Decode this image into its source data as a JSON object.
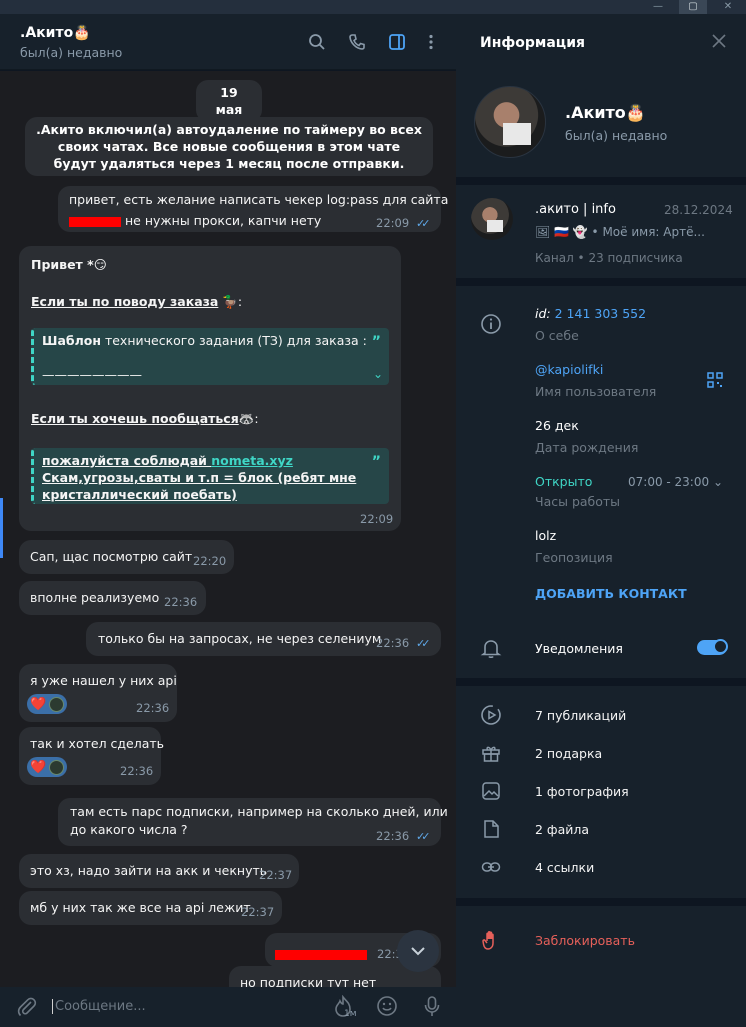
{
  "window": {
    "minimize_glyph": "—",
    "maximize_glyph": "▢",
    "close_glyph": "✕"
  },
  "chat": {
    "name": ".Акито",
    "name_emoji": "🎂",
    "status": "был(а) недавно",
    "icons": [
      "search-icon",
      "phone-icon",
      "sidebar-toggle-icon",
      "more-vertical-icon"
    ]
  },
  "messages": {
    "date": "19 мая",
    "service_text": ".Акито включил(а) автоудаление по таймеру во всех своих чатах. Все новые сообщения в этом чате будут удаляться через 1 месяц после отправки.",
    "m1": {
      "line1": "привет, есть желание написать чекер log:pass для сайта",
      "line2": "не нужны прокси, капчи нету",
      "time": "22:09"
    },
    "m2": {
      "greeting": "Привет",
      "greeting_emoji": "*😏",
      "order_heading": "Если ты по поводу заказа",
      "order_suffix": ":",
      "quote1_bold": "Шаблон",
      "quote1_text": " технического задания (ТЗ) для заказа :",
      "quote1_line2": "————————",
      "chat_heading": "Если ты хочешь пообщаться",
      "chat_suffix": ":",
      "quote2_prefix": "пожалуйста соблюдай ",
      "quote2_link": "nometa.xyz",
      "quote2_rest": "Скам,угрозы,сваты и т.п = блок (ребят мне кристаллический поебать)",
      "time": "22:09"
    },
    "m3": {
      "text": "Сап, щас посмотрю сайт",
      "time": "22:20"
    },
    "m4": {
      "text": "вполне реализуемо",
      "time": "22:36"
    },
    "m5": {
      "text": "только бы на запросах, не через селениум",
      "time": "22:36"
    },
    "m6": {
      "text": "я уже нашел у них api",
      "time": "22:36",
      "reaction": "❤️"
    },
    "m7": {
      "text": "так и хотел сделать",
      "time": "22:36",
      "reaction": "❤️"
    },
    "m8": {
      "line1": "там есть парс подписки, например на сколько дней, или",
      "line2": "до какого числа ?",
      "time": "22:36"
    },
    "m9": {
      "text": "это хз, надо зайти на акк и чекнуть",
      "time": "22:37"
    },
    "m10": {
      "text": "мб у них так же все на api лежит",
      "time": "22:37"
    },
    "m11": {
      "time": "22:3"
    },
    "m12": {
      "text": "но подписки тут нет"
    }
  },
  "composer": {
    "placeholder": "Сообщение...",
    "timer_label": "1м"
  },
  "info": {
    "title": "Информация",
    "name": ".Акито",
    "name_emoji": "🎂",
    "status": "был(а) недавно",
    "channel": {
      "name": ".акито | info",
      "date": "28.12.2024",
      "preview": "🖼 🇷🇺 👻  • Моё имя: Артё...",
      "subscribers": "Канал • 23 подписчика"
    },
    "id_label": "id:",
    "id_value": "2 141 303 552",
    "about_label": "О себе",
    "username": "@kapiolifki",
    "username_label": "Имя пользователя",
    "birthday": "26 дек",
    "birthday_label": "Дата рождения",
    "open_status": "Открыто",
    "hours": "07:00 - 23:00 ⌄",
    "hours_label": "Часы работы",
    "location": "lolz",
    "location_label": "Геопозиция",
    "add_contact": "ДОБАВИТЬ КОНТАКТ",
    "notifications": "Уведомления",
    "notifications_on": true,
    "publications": "7 публикаций",
    "gifts": "2 подарка",
    "photos": "1 фотография",
    "files": "2 файла",
    "links": "4 ссылки",
    "block": "Заблокировать"
  },
  "colors": {
    "accent": "#4ea4f6",
    "teal": "#3fd6c6",
    "danger": "#e5605a",
    "panel": "#17212b",
    "chat_bg": "#1c1d21"
  }
}
